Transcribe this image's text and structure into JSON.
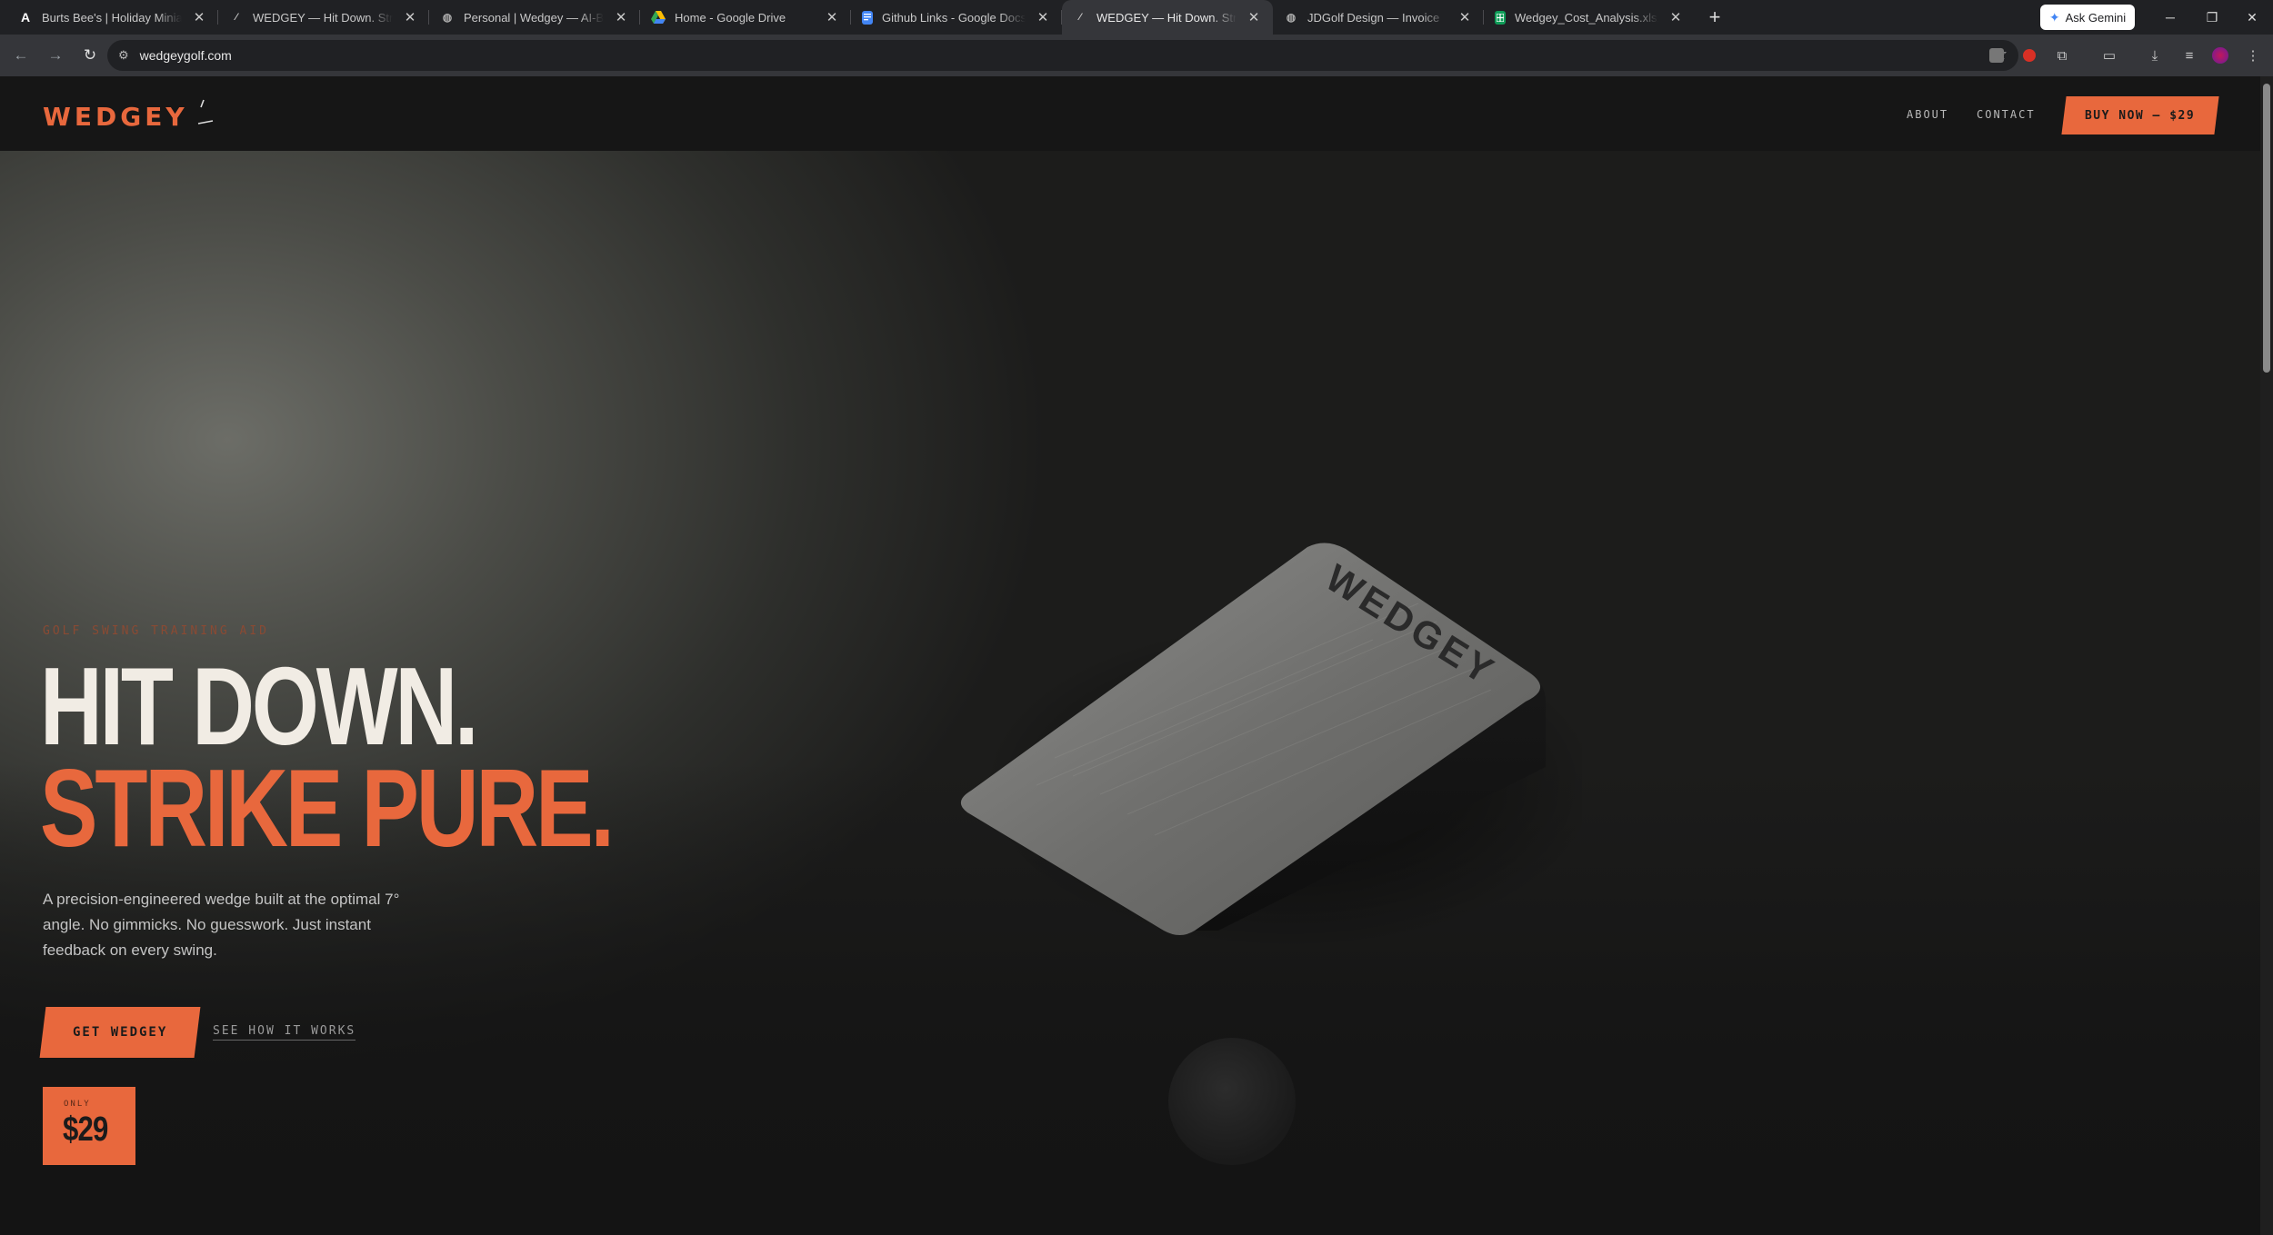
{
  "browser": {
    "tabs": [
      {
        "title": "Burts Bee's | Holiday Miniatures",
        "icon": "anthropic-icon",
        "active": false
      },
      {
        "title": "WEDGEY — Hit Down. Strike Pure.",
        "icon": "wedgey-icon",
        "active": false
      },
      {
        "title": "Personal | Wedgey — AI-Built Design",
        "icon": "globe-icon",
        "active": false
      },
      {
        "title": "Home - Google Drive",
        "icon": "drive-icon",
        "active": false
      },
      {
        "title": "Github Links - Google Docs",
        "icon": "docs-icon",
        "active": false
      },
      {
        "title": "WEDGEY — Hit Down. Strike Pure.",
        "icon": "wedgey-icon",
        "active": true
      },
      {
        "title": "JDGolf Design — Invoice",
        "icon": "globe-icon",
        "active": false
      },
      {
        "title": "Wedgey_Cost_Analysis.xlsx - Google Sheets",
        "icon": "sheets-icon",
        "active": false
      }
    ],
    "gemini_label": "Ask Gemini",
    "url": "wedgeygolf.com"
  },
  "site": {
    "logo": "WEDGEY",
    "nav": {
      "about": "ABOUT",
      "contact": "CONTACT",
      "buy": "BUY NOW — $29"
    },
    "hero": {
      "eyebrow": "GOLF SWING TRAINING AID",
      "headline_1": "HIT DOWN.",
      "headline_2": "STRIKE PURE.",
      "lead": "A precision-engineered wedge built at the optimal 7° angle. No gimmicks. No guesswork. Just instant feedback on every swing.",
      "cta": "GET WEDGEY",
      "secondary": "SEE HOW IT WORKS",
      "price_prefix": "ONLY",
      "price": "$29",
      "product_engraving": "WEDGEY"
    }
  },
  "colors": {
    "accent": "#e8683d",
    "nav_bg": "#161616",
    "headline_light": "#f1ece4"
  }
}
